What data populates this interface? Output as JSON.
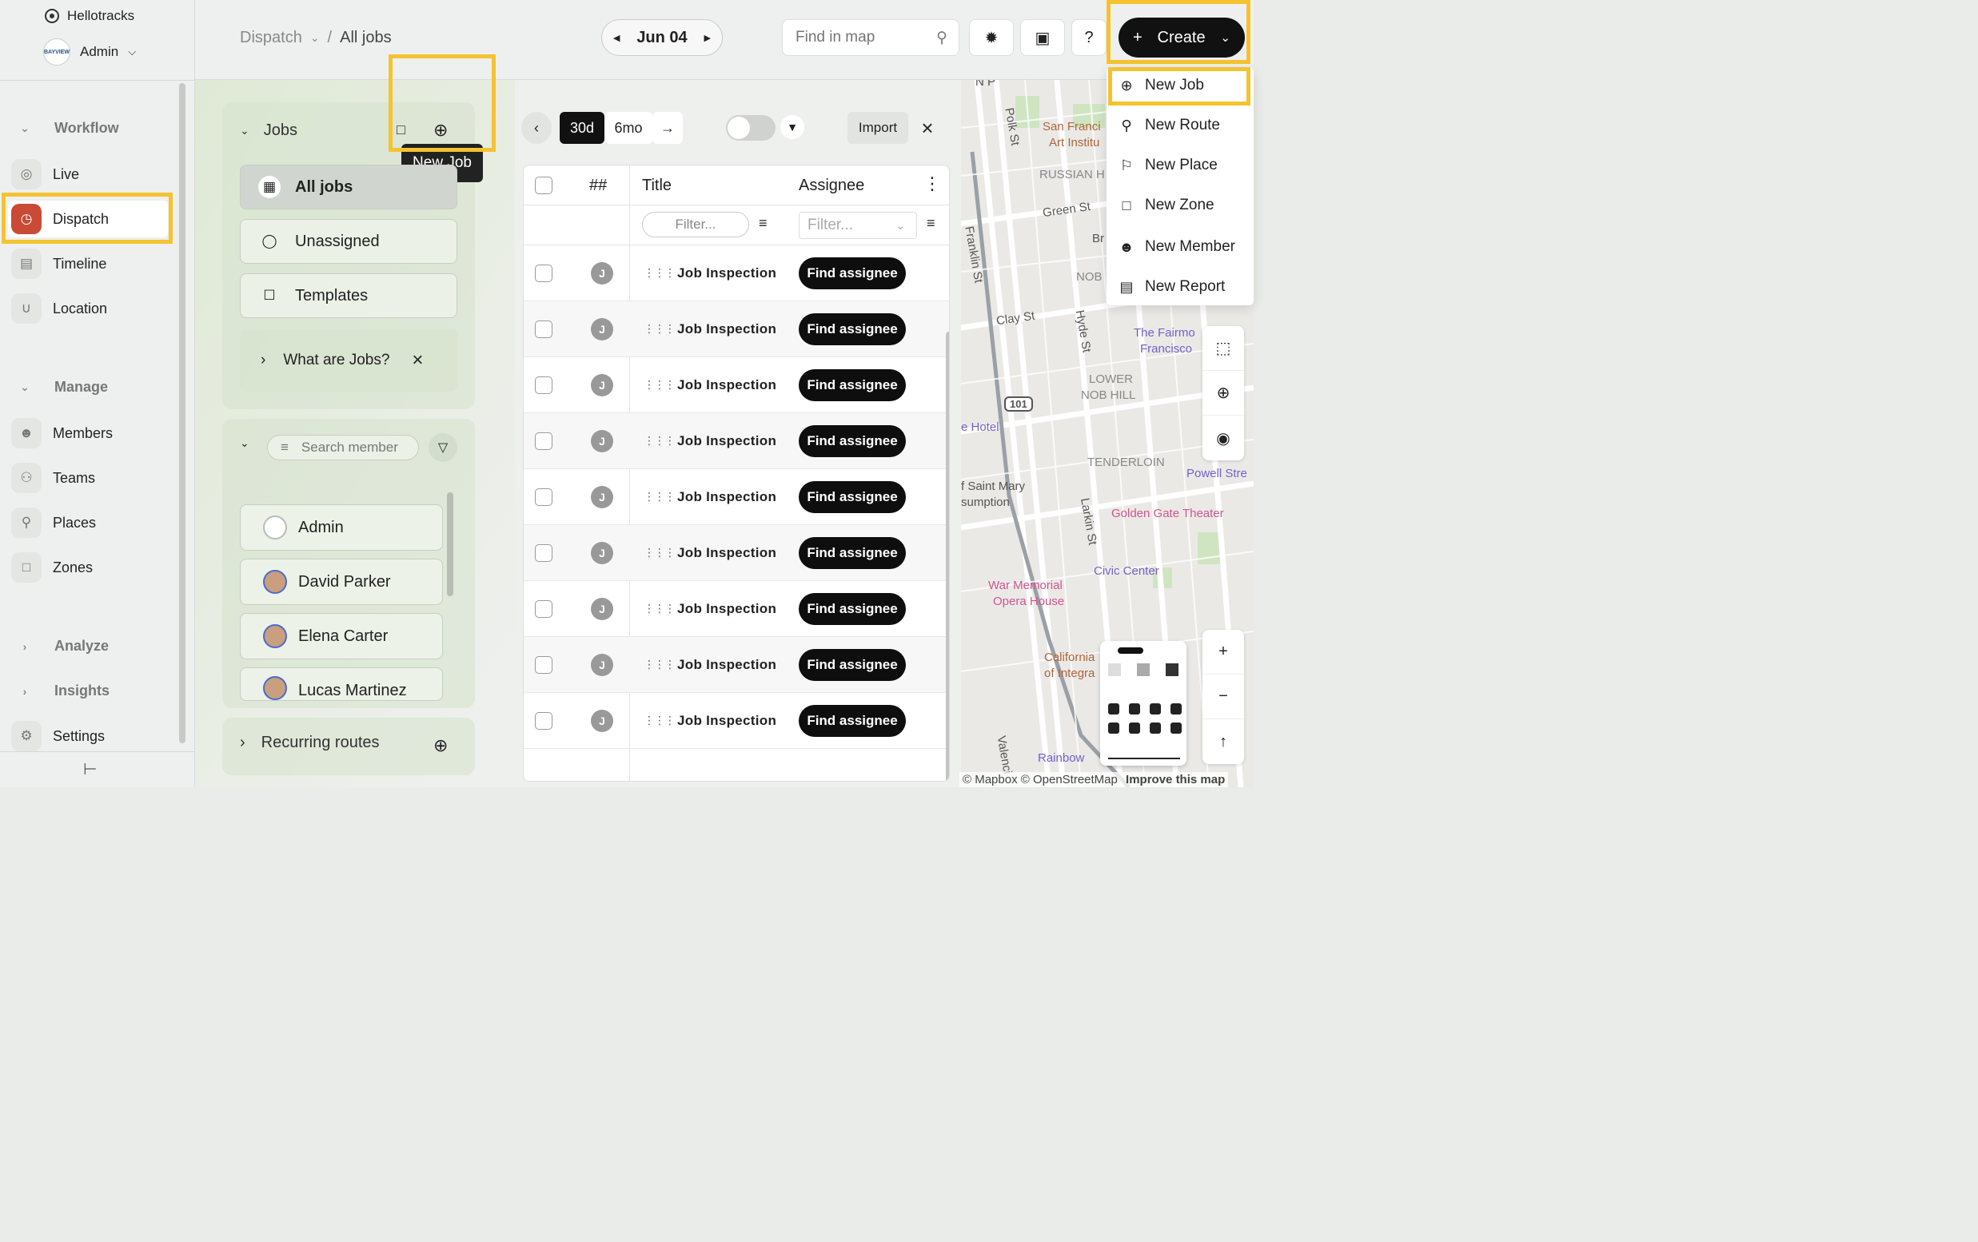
{
  "app": {
    "name": "Hellotracks",
    "account": "Admin"
  },
  "sidebar": {
    "sections": [
      {
        "label": "Workflow",
        "expanded": true
      },
      {
        "label": "Manage",
        "expanded": true
      },
      {
        "label": "Analyze",
        "expanded": false
      },
      {
        "label": "Insights",
        "expanded": false
      }
    ],
    "workflow_items": [
      {
        "label": "Live",
        "icon": "live-icon"
      },
      {
        "label": "Dispatch",
        "icon": "dispatch-icon",
        "active": true
      },
      {
        "label": "Timeline",
        "icon": "timeline-icon"
      },
      {
        "label": "Location",
        "icon": "location-icon"
      }
    ],
    "manage_items": [
      {
        "label": "Members",
        "icon": "members-icon"
      },
      {
        "label": "Teams",
        "icon": "teams-icon"
      },
      {
        "label": "Places",
        "icon": "places-icon"
      },
      {
        "label": "Zones",
        "icon": "zones-icon"
      }
    ],
    "settings": "Settings"
  },
  "header": {
    "breadcrumb_parent": "Dispatch",
    "breadcrumb_sep": "/",
    "breadcrumb_current": "All jobs",
    "date": "Jun 04",
    "find_placeholder": "Find in map",
    "help": "?",
    "create_label": "Create"
  },
  "create_menu": {
    "items": [
      "New Job",
      "New Route",
      "New Place",
      "New Zone",
      "New Member",
      "New Report"
    ]
  },
  "jobs_panel": {
    "title": "Jobs",
    "tooltip": "New Job",
    "lists": [
      "All jobs",
      "Unassigned",
      "Templates"
    ],
    "info": "What are Jobs?",
    "member_search_placeholder": "Search member",
    "members": [
      "Admin",
      "David Parker",
      "Elena Carter",
      "Lucas Martinez"
    ],
    "recurring": "Recurring routes"
  },
  "toolbar": {
    "range_30d": "30d",
    "range_6mo": "6mo",
    "import": "Import"
  },
  "table": {
    "col_num": "##",
    "col_title": "Title",
    "col_assignee": "Assignee",
    "filter_placeholder": "Filter...",
    "rows": [
      {
        "avatar": "J",
        "title": "Job Inspection",
        "action": "Find assignee"
      },
      {
        "avatar": "J",
        "title": "Job Inspection",
        "action": "Find assignee"
      },
      {
        "avatar": "J",
        "title": "Job Inspection",
        "action": "Find assignee"
      },
      {
        "avatar": "J",
        "title": "Job Inspection",
        "action": "Find assignee"
      },
      {
        "avatar": "J",
        "title": "Job Inspection",
        "action": "Find assignee"
      },
      {
        "avatar": "J",
        "title": "Job Inspection",
        "action": "Find assignee"
      },
      {
        "avatar": "J",
        "title": "Job Inspection",
        "action": "Find assignee"
      },
      {
        "avatar": "J",
        "title": "Job Inspection",
        "action": "Find assignee"
      },
      {
        "avatar": "J",
        "title": "Job Inspection",
        "action": "Find assignee"
      }
    ]
  },
  "map": {
    "labels": [
      "Polk St",
      "San Franci",
      "Art Institu",
      "RUSSIAN H",
      "Green St",
      "Br",
      "Franklin St",
      "NOB",
      "Clay St",
      "Hyde St",
      "The Fairmo",
      "Francisco",
      "LOWER",
      "NOB HILL",
      "101",
      "e Hotel",
      "TENDERLOIN",
      "Powell Stre",
      "f Saint Mary",
      "sumption",
      "Golden Gate Theater",
      "Larkin St",
      "Civic Center",
      "War Memorial",
      "Opera House",
      "California",
      "of Integra",
      "Rainbow",
      "Valenci",
      "N P"
    ],
    "attribution": "© Mapbox © OpenStreetMap",
    "improve": "Improve this map"
  },
  "colors": {
    "accent": "#c94b36",
    "highlight": "#f5c330",
    "primary": "#111111"
  }
}
